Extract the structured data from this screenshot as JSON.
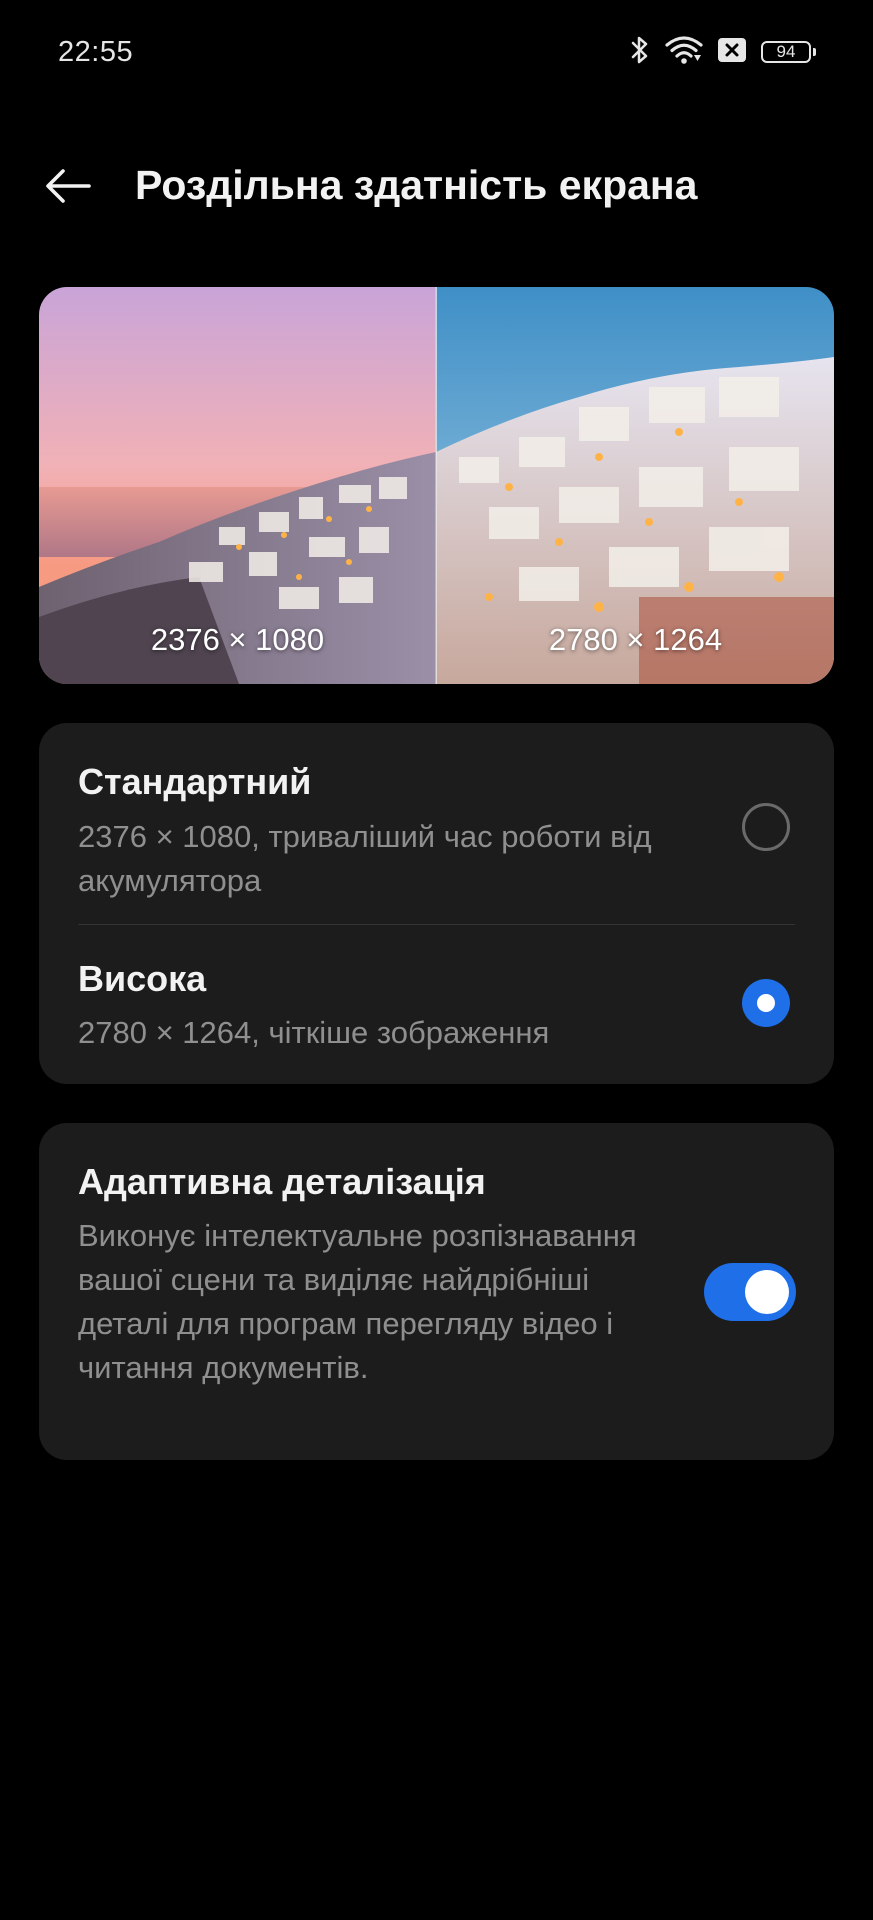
{
  "status_bar": {
    "time": "22:55",
    "battery_level": "94",
    "icons": [
      "bluetooth-icon",
      "wifi-icon",
      "sim-off-icon",
      "battery-icon"
    ]
  },
  "header": {
    "title": "Роздільна здатність екрана",
    "back_icon": "arrow-left-icon"
  },
  "preview": {
    "left_label": "2376 × 1080",
    "right_label": "2780 × 1264"
  },
  "resolution_options": [
    {
      "title": "Стандартний",
      "description": "2376 × 1080, триваліший час роботи від акумулятора",
      "selected": false
    },
    {
      "title": "Висока",
      "description": "2780 × 1264, чіткіше зображення",
      "selected": true
    }
  ],
  "adaptive": {
    "title": "Адаптивна деталізація",
    "description": "Виконує інтелектуальне розпізнавання вашої сцени та виділяє найдрібніші деталі для програм перегляду відео і читання документів.",
    "enabled": true
  },
  "colors": {
    "background": "#000000",
    "card": "#1c1c1c",
    "accent": "#1f6fe8",
    "secondary_text": "#8f8f8f"
  }
}
